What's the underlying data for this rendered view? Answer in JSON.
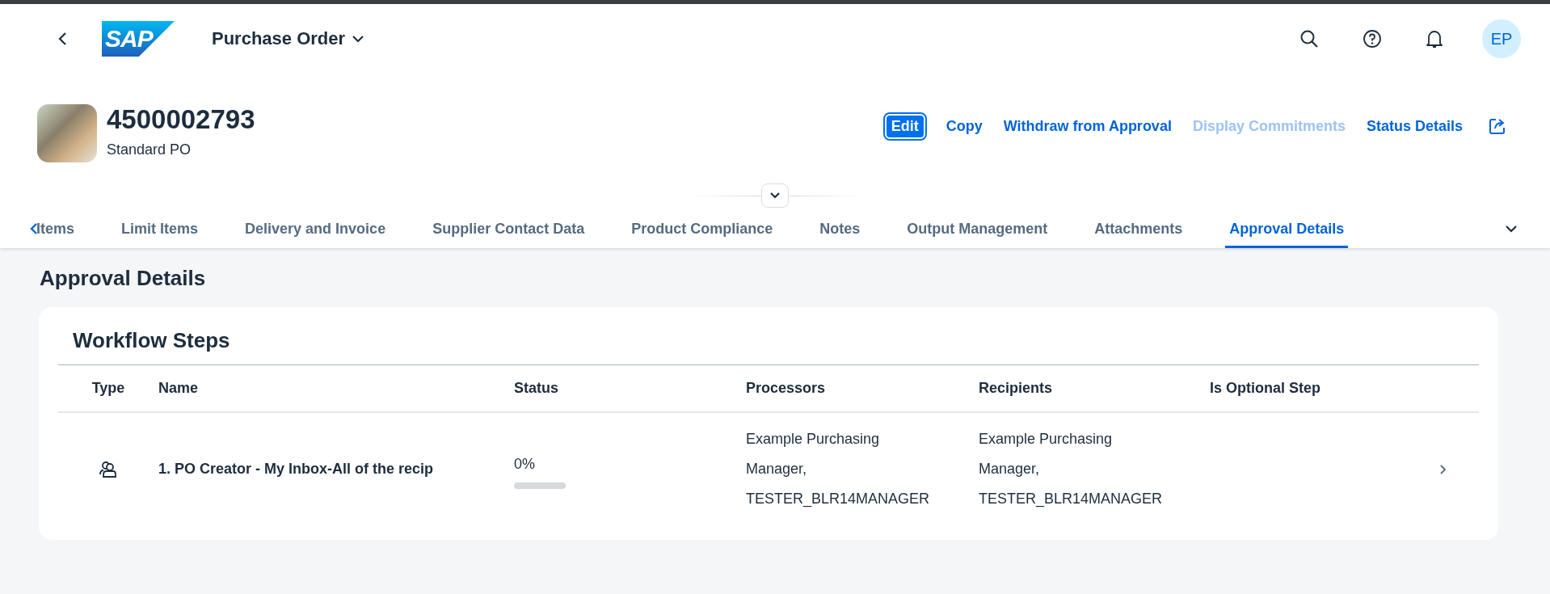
{
  "shell": {
    "logo": "SAP",
    "app_title": "Purchase Order",
    "avatar": "EP"
  },
  "object": {
    "title": "4500002793",
    "subtitle": "Standard PO",
    "actions": [
      {
        "label": "Edit",
        "kind": "emphasized",
        "disabled": false
      },
      {
        "label": "Copy",
        "kind": "link",
        "disabled": false
      },
      {
        "label": "Withdraw from Approval",
        "kind": "link",
        "disabled": false
      },
      {
        "label": "Display Commitments",
        "kind": "link",
        "disabled": true
      },
      {
        "label": "Status Details",
        "kind": "link",
        "disabled": false
      }
    ]
  },
  "tabs": [
    {
      "label": "Items",
      "selected": false
    },
    {
      "label": "Limit Items",
      "selected": false
    },
    {
      "label": "Delivery and Invoice",
      "selected": false
    },
    {
      "label": "Supplier Contact Data",
      "selected": false
    },
    {
      "label": "Product Compliance",
      "selected": false
    },
    {
      "label": "Notes",
      "selected": false
    },
    {
      "label": "Output Management",
      "selected": false
    },
    {
      "label": "Attachments",
      "selected": false
    },
    {
      "label": "Approval Details",
      "selected": true
    }
  ],
  "section_title": "Approval Details",
  "workflow": {
    "title": "Workflow Steps",
    "columns": [
      "Type",
      "Name",
      "Status",
      "Processors",
      "Recipients",
      "Is Optional Step"
    ],
    "rows": [
      {
        "name": "1. PO Creator - My Inbox-All of the recip",
        "status": "0%",
        "level": 0,
        "processors": [
          "Example Purchasing",
          "Manager,",
          "TESTER_BLR14MANAGER"
        ],
        "recipients": [
          "Example Purchasing",
          "Manager,",
          "TESTER_BLR14MANAGER"
        ]
      }
    ]
  }
}
